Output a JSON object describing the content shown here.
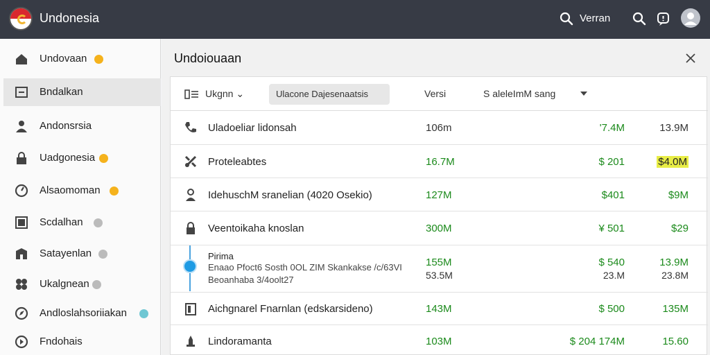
{
  "app": {
    "title": "Undonesia",
    "search_label": "Verran"
  },
  "sidebar": {
    "items": [
      {
        "label": "Undovaan",
        "icon": "home-icon",
        "badge": "#f5b21c"
      },
      {
        "label": "Bndalkan",
        "icon": "list-icon",
        "badge": ""
      },
      {
        "label": "Andonsrsia",
        "icon": "user-icon",
        "badge": ""
      },
      {
        "label": "Uadgonesia",
        "icon": "lock-icon",
        "badge": "#f5b21c"
      },
      {
        "label": "Alsaomoman",
        "icon": "clock-icon",
        "badge": "#f5b21c"
      },
      {
        "label": "Scdalhan",
        "icon": "box-icon",
        "badge": "#bbbbbb"
      },
      {
        "label": "Satayenlan",
        "icon": "building-icon",
        "badge": "#bbbbbb"
      },
      {
        "label": "Ukalgnean",
        "icon": "grid-icon",
        "badge": "#bbbbbb"
      },
      {
        "label": "Andloslahsoriiakan",
        "icon": "compass-icon",
        "badge": "#6fc7d3"
      },
      {
        "label": "Fndohais",
        "icon": "globe-icon",
        "badge": ""
      }
    ]
  },
  "panel": {
    "title": "Undoiouaan",
    "toolbar": {
      "group_label": "Ukgnn",
      "chip_label": "Ulacone Dajesenaatsis",
      "version_label": "Versi",
      "sort_label": "S aleleImM sang"
    },
    "rows": [
      {
        "icon": "phone-icon",
        "name": "Uladoeliar lidonsah",
        "c1": "106m",
        "c2": "'7.4M",
        "c3": "13.9M"
      },
      {
        "icon": "settings-icon",
        "name": "Proteleabtes",
        "c1": "16.7M",
        "c2": "$ 201",
        "c3": "$4.0M"
      },
      {
        "icon": "user-icon",
        "name": "IdehuschM sranelian (4020 Osekio)",
        "c1": "127M",
        "c2": "$401",
        "c3": "$9M"
      },
      {
        "icon": "lock-icon",
        "name": "Veentoikaha knoslan",
        "c1": "300M",
        "c2": "¥ 501",
        "c3": "$29"
      },
      {
        "icon": "timeline-dot",
        "name": "Pirima",
        "sub1": "Enaao Pfoct6 Sosth 0OL ZIM Skankakse /c/63VI",
        "sub2": "Beoanhaba 3/4oolt27",
        "c1": "155M",
        "c1b": "53.5M",
        "c2": "$ 540",
        "c2b": "23.M",
        "c3": "13.9M",
        "c3b": "23.8M"
      },
      {
        "icon": "book-icon",
        "name": "Aichgnarel Fnarnlan (edskarsideno)",
        "c1": "143M",
        "c2": "$ 500",
        "c3": "135M"
      },
      {
        "icon": "building-icon",
        "name": "Lindoramanta",
        "c1": "103M",
        "c2": "$ 204 174M",
        "c3": "15.60"
      }
    ]
  },
  "colors": {
    "topbar": "#373b45",
    "green": "#1b8a1b",
    "highlight": "#e8ed45",
    "accent": "#1e9be4"
  }
}
